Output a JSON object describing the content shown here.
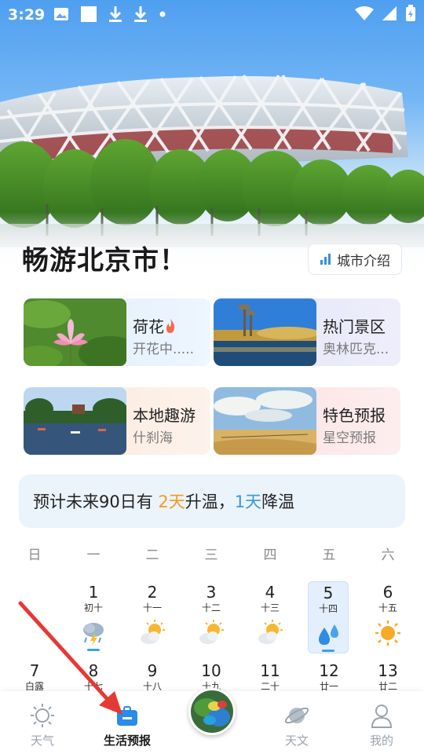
{
  "status_bar": {
    "time": "3:29",
    "icons": [
      "image-icon",
      "square-icon",
      "download-icon",
      "download-icon",
      "dot-icon"
    ],
    "right_icons": [
      "wifi-icon",
      "signal-icon",
      "battery-icon"
    ]
  },
  "hero": {
    "title": "畅游北京市！",
    "intro_button": "城市介绍"
  },
  "cards": [
    {
      "title": "荷花",
      "subtitle": "开花中.....",
      "has_fire": true
    },
    {
      "title": "热门景区",
      "subtitle": "奥林匹克..."
    },
    {
      "title": "本地趣游",
      "subtitle": "什刹海"
    },
    {
      "title": "特色预报",
      "subtitle": "星空预报"
    }
  ],
  "banner": {
    "prefix": "预计未来90日有 ",
    "warm_days": "2天",
    "middle": "升温，",
    "cool_days": "1天",
    "suffix": "降温"
  },
  "calendar": {
    "weekdays": [
      "日",
      "一",
      "二",
      "三",
      "四",
      "五",
      "六"
    ],
    "week1": [
      {
        "day": "1",
        "lunar": "初十",
        "weather": "thunderstorm-icon",
        "bar": true
      },
      {
        "day": "2",
        "lunar": "十一",
        "weather": "partly-sunny-icon",
        "bar": false
      },
      {
        "day": "3",
        "lunar": "十二",
        "weather": "partly-sunny-icon",
        "bar": false
      },
      {
        "day": "4",
        "lunar": "十三",
        "weather": "partly-sunny-icon",
        "bar": false
      },
      {
        "day": "5",
        "lunar": "十四",
        "weather": "rain-drops-icon",
        "bar": true,
        "selected": true
      },
      {
        "day": "6",
        "lunar": "十五",
        "weather": "sunny-icon",
        "bar": false
      }
    ],
    "week2": [
      {
        "day": "7",
        "lunar": "白露"
      },
      {
        "day": "8",
        "lunar": "十七"
      },
      {
        "day": "9",
        "lunar": "十八"
      },
      {
        "day": "10",
        "lunar": "十九"
      },
      {
        "day": "11",
        "lunar": "二十"
      },
      {
        "day": "12",
        "lunar": "廿一"
      },
      {
        "day": "13",
        "lunar": "廿二"
      }
    ]
  },
  "bottom_nav": [
    {
      "label": "天气",
      "icon": "sun-icon",
      "active": false
    },
    {
      "label": "生活预报",
      "icon": "briefcase-icon",
      "active": true
    },
    {
      "label": "",
      "icon": "radar-map-icon",
      "active": false
    },
    {
      "label": "天文",
      "icon": "planet-icon",
      "active": false
    },
    {
      "label": "我的",
      "icon": "user-icon",
      "active": false
    }
  ],
  "colors": {
    "accent_blue": "#3a9ad9",
    "warm_orange": "#f39a1e",
    "arrow_red": "#e53935"
  }
}
